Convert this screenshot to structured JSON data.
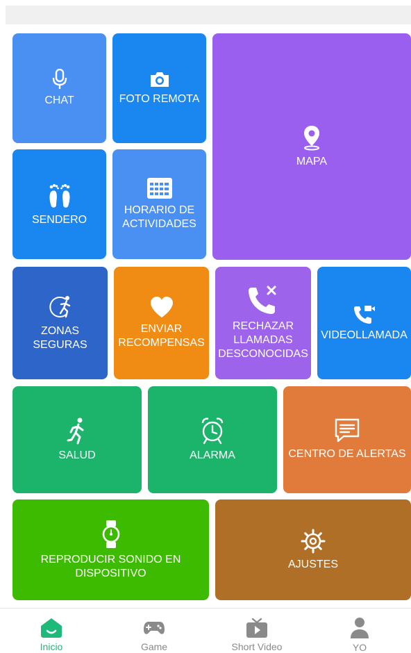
{
  "colors": {
    "blue_light": "#4a90f2",
    "blue": "#1a86f0",
    "purple": "#9b5ff0",
    "navy": "#2d66c8",
    "orange": "#f08c14",
    "purple_medium": "#9d63ea",
    "green": "#1cb36b",
    "coral": "#e07b3c",
    "lime": "#3dbb00",
    "brown": "#b06f26",
    "nav_active": "#1fb97a",
    "nav_inactive": "#8a8a8a"
  },
  "tiles": {
    "chat": {
      "label": "CHAT",
      "icon": "microphone-icon"
    },
    "remote_photo": {
      "label": "FOTO REMOTA",
      "icon": "camera-icon"
    },
    "map": {
      "label": "MAPA",
      "icon": "location-pin-icon"
    },
    "trail": {
      "label": "SENDERO",
      "icon": "footprints-icon"
    },
    "schedule": {
      "label": "HORARIO DE\nACTIVIDADES",
      "icon": "calendar-grid-icon"
    },
    "safe_zones": {
      "label": "ZONAS SEGURAS",
      "icon": "runner-circle-icon"
    },
    "rewards": {
      "label": "ENVIAR\nRECOMPENSAS",
      "icon": "heart-icon"
    },
    "reject_calls": {
      "label": "RECHAZAR\nLLAMADAS\nDESCONOCIDAS",
      "icon": "phone-reject-icon"
    },
    "videocall": {
      "label": "VIDEOLLAMADA",
      "icon": "video-call-icon"
    },
    "health": {
      "label": "SALUD",
      "icon": "running-person-icon"
    },
    "alarm": {
      "label": "ALARMA",
      "icon": "alarm-clock-icon"
    },
    "alerts": {
      "label": "CENTRO DE ALERTAS",
      "icon": "message-icon"
    },
    "play_sound": {
      "label": "REPRODUCIR SONIDO EN\nDISPOSITIVO",
      "icon": "watch-icon"
    },
    "settings": {
      "label": "AJUSTES",
      "icon": "gear-icon"
    }
  },
  "bottom_nav": {
    "items": [
      {
        "label": "Inicio",
        "icon": "home-icon",
        "active": true
      },
      {
        "label": "Game",
        "icon": "gamepad-icon",
        "active": false
      },
      {
        "label": "Short Video",
        "icon": "tv-play-icon",
        "active": false
      },
      {
        "label": "YO",
        "icon": "person-icon",
        "active": false
      }
    ]
  }
}
